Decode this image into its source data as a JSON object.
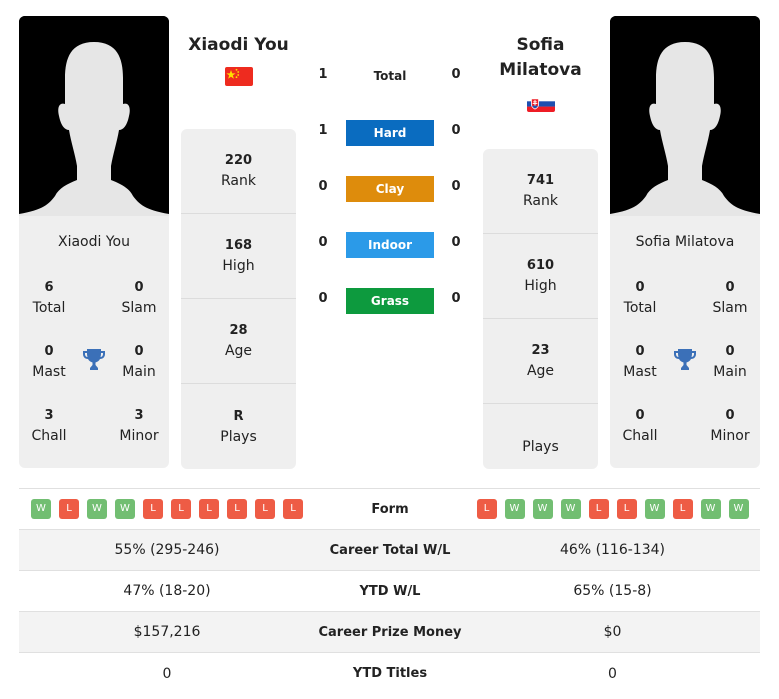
{
  "player1": {
    "name": "Xiaodi You",
    "card_name": "Xiaodi You",
    "country": "China",
    "flag_icon": "flag-china",
    "titles": {
      "total": {
        "value": "6",
        "label": "Total"
      },
      "slam": {
        "value": "0",
        "label": "Slam"
      },
      "mast": {
        "value": "0",
        "label": "Mast"
      },
      "main": {
        "value": "0",
        "label": "Main"
      },
      "chall": {
        "value": "3",
        "label": "Chall"
      },
      "minor": {
        "value": "3",
        "label": "Minor"
      }
    },
    "stats": [
      {
        "value": "220",
        "label": "Rank"
      },
      {
        "value": "168",
        "label": "High"
      },
      {
        "value": "28",
        "label": "Age"
      },
      {
        "value": "R",
        "label": "Plays"
      }
    ]
  },
  "player2": {
    "name_line1": "Sofia",
    "name_line2": "Milatova",
    "card_name": "Sofia Milatova",
    "country": "Slovakia",
    "flag_icon": "flag-slovakia",
    "titles": {
      "total": {
        "value": "0",
        "label": "Total"
      },
      "slam": {
        "value": "0",
        "label": "Slam"
      },
      "mast": {
        "value": "0",
        "label": "Mast"
      },
      "main": {
        "value": "0",
        "label": "Main"
      },
      "chall": {
        "value": "0",
        "label": "Chall"
      },
      "minor": {
        "value": "0",
        "label": "Minor"
      }
    },
    "stats": [
      {
        "value": "741",
        "label": "Rank"
      },
      {
        "value": "610",
        "label": "High"
      },
      {
        "value": "23",
        "label": "Age"
      },
      {
        "value": "",
        "label": "Plays"
      }
    ]
  },
  "h2h": [
    {
      "label": "Total",
      "p1": "1",
      "p2": "0",
      "color": ""
    },
    {
      "label": "Hard",
      "p1": "1",
      "p2": "0",
      "color": "#0a6cc0"
    },
    {
      "label": "Clay",
      "p1": "0",
      "p2": "0",
      "color": "#de8c0c"
    },
    {
      "label": "Indoor",
      "p1": "0",
      "p2": "0",
      "color": "#2b9ae8"
    },
    {
      "label": "Grass",
      "p1": "0",
      "p2": "0",
      "color": "#0d9a3e"
    }
  ],
  "comparison": {
    "form_label": "Form",
    "p1_form": [
      "W",
      "L",
      "W",
      "W",
      "L",
      "L",
      "L",
      "L",
      "L",
      "L"
    ],
    "p2_form": [
      "L",
      "W",
      "W",
      "W",
      "L",
      "L",
      "W",
      "L",
      "W",
      "W"
    ],
    "rows": [
      {
        "label": "Career Total W/L",
        "p1": "55% (295-246)",
        "p2": "46% (116-134)"
      },
      {
        "label": "YTD W/L",
        "p1": "47% (18-20)",
        "p2": "65% (15-8)"
      },
      {
        "label": "Career Prize Money",
        "p1": "$157,216",
        "p2": "$0"
      },
      {
        "label": "YTD Titles",
        "p1": "0",
        "p2": "0"
      }
    ]
  }
}
